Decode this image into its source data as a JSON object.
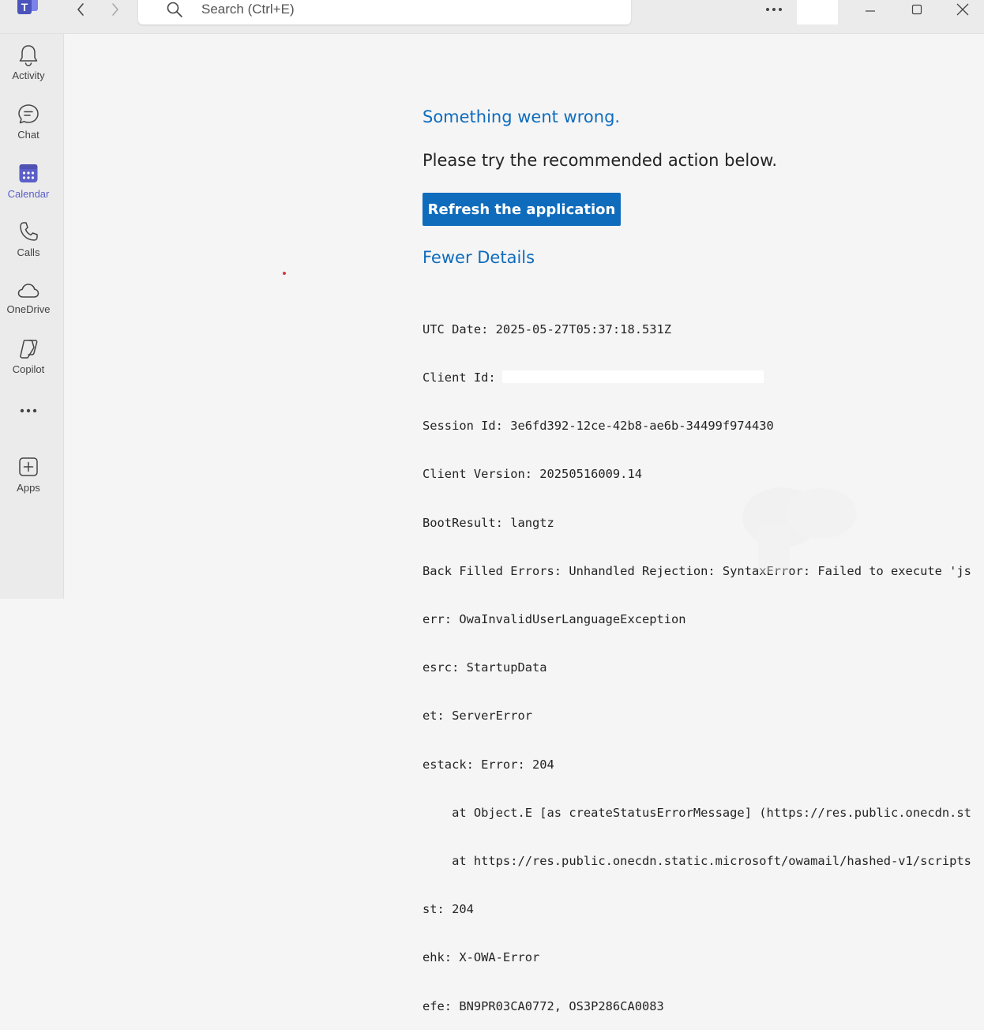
{
  "titlebar": {
    "search_placeholder": "Search (Ctrl+E)",
    "icons": [
      "teams-logo-icon",
      "chevron-left-icon",
      "chevron-right-icon",
      "search-icon",
      "more-icon",
      "minimize-icon",
      "maximize-icon",
      "close-icon"
    ]
  },
  "rail": {
    "items": [
      {
        "label": "Activity",
        "icon": "bell-icon",
        "active": false
      },
      {
        "label": "Chat",
        "icon": "chat-icon",
        "active": false
      },
      {
        "label": "Calendar",
        "icon": "calendar-icon",
        "active": true
      },
      {
        "label": "Calls",
        "icon": "phone-icon",
        "active": false
      },
      {
        "label": "OneDrive",
        "icon": "cloud-icon",
        "active": false
      },
      {
        "label": "Copilot",
        "icon": "copilot-icon",
        "active": false
      },
      {
        "label": "",
        "icon": "more-icon",
        "active": false
      },
      {
        "label": "Apps",
        "icon": "add-app-icon",
        "active": false
      }
    ],
    "active_color": "#5b5fc7"
  },
  "error": {
    "title": "Something went wrong.",
    "subtitle": "Please try the recommended action below.",
    "action_label": "Refresh the application",
    "details_toggle": "Fewer Details",
    "accent_color": "#0f6cbd",
    "details": {
      "utc_date": "UTC Date: 2025-05-27T05:37:18.531Z",
      "client_id": "Client Id:",
      "session_id": "Session Id: 3e6fd392-12ce-42b8-ae6b-34499f974430",
      "client_version": "Client Version: 20250516009.14",
      "boot_result": "BootResult: langtz",
      "back_filled": "Back Filled Errors: Unhandled Rejection: SyntaxError: Failed to execute 'js",
      "err": "err: OwaInvalidUserLanguageException",
      "esrc": "esrc: StartupData",
      "et": "et: ServerError",
      "estack": "estack: Error: 204",
      "estack_line1": "    at Object.E [as createStatusErrorMessage] (https://res.public.onecdn.st",
      "estack_line2": "    at https://res.public.onecdn.static.microsoft/owamail/hashed-v1/scripts",
      "st": "st: 204",
      "ehk": "ehk: X-OWA-Error",
      "efe": "efe: BN9PR03CA0772, OS3P286CA0083"
    }
  }
}
